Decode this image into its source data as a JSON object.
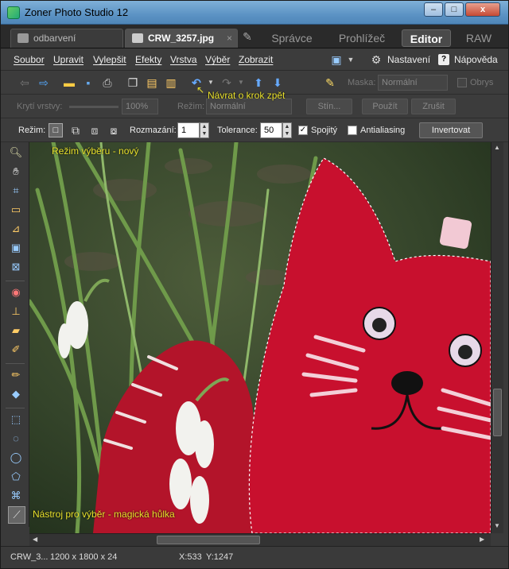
{
  "window": {
    "title": "Zoner Photo Studio 12",
    "minimize": "–",
    "maximize": "□",
    "close": "x"
  },
  "doc_tabs": [
    {
      "label": "odbarvení"
    },
    {
      "label": "CRW_3257.jpg",
      "close": "×"
    }
  ],
  "mode_tabs": [
    "Správce",
    "Prohlížeč",
    "Editor",
    "RAW"
  ],
  "menu": [
    "Soubor",
    "Upravit",
    "Vylepšit",
    "Efekty",
    "Vrstva",
    "Výběr",
    "Zobrazit"
  ],
  "menu_right": {
    "settings": "Nastavení",
    "help": "Nápověda"
  },
  "toolbar1": {
    "mask_label": "Maska:",
    "mask_value": "Normální",
    "opacity_checkbox_label": "Obrys"
  },
  "toolbar2": {
    "opacity_label": "Krytí vrstvy:",
    "opacity_value": "100%",
    "mode_label": "Režim:",
    "mode_value": "Normální",
    "shadow_button": "Stín...",
    "apply_button": "Použít",
    "cancel_button": "Zrušit"
  },
  "toolbar3": {
    "mode_label": "Režim:",
    "blur_label": "Rozmazání:",
    "blur_value": "1",
    "tolerance_label": "Tolerance:",
    "tolerance_value": "50",
    "contiguous_label": "Spojitý",
    "antialias_label": "Antialiasing",
    "invert_button": "Invertovat"
  },
  "annotations": {
    "undo_tip": "Návrat o krok zpět",
    "mode_tip": "Režim výběru - nový",
    "tool_tip": "Nástroj pro výběr - magická hůlka"
  },
  "status": {
    "file": "CRW_3...",
    "dimensions": "1200 x 1800 x 24",
    "x": "X:533",
    "y": "Y:1247"
  },
  "colors": {
    "titlebar": "#5c93c4",
    "panel": "#3c3c3c",
    "annotation": "#e8e02c",
    "cat_red": "#c8102e"
  }
}
